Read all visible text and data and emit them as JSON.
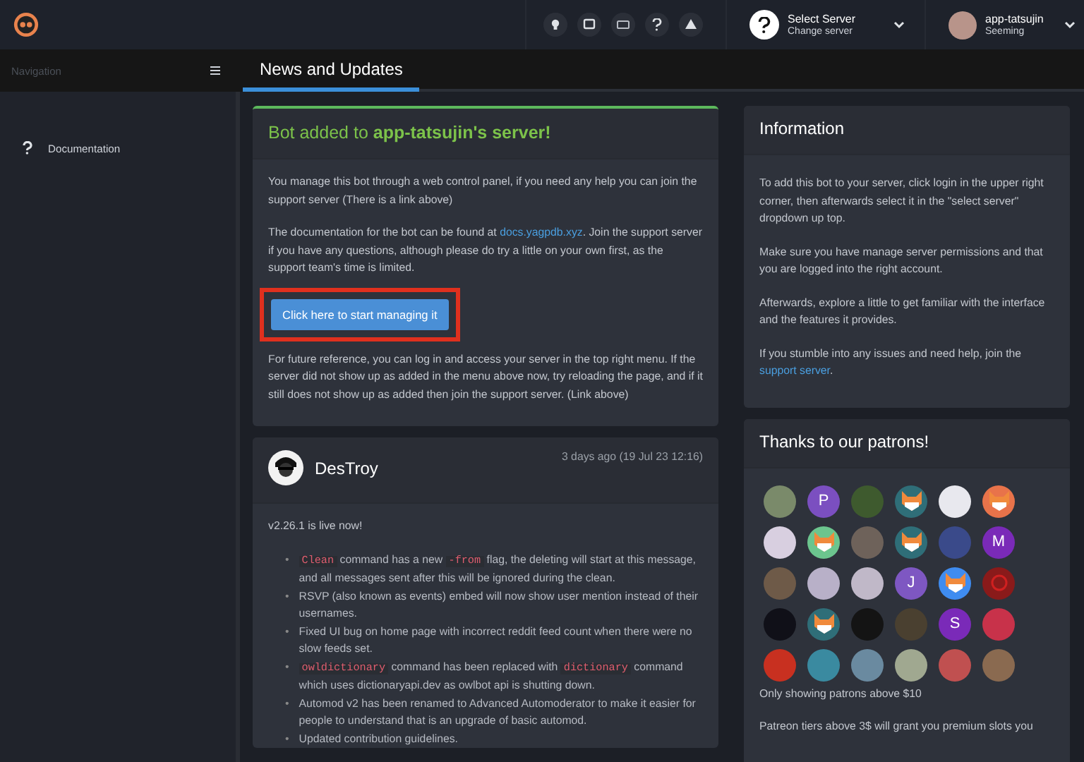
{
  "topbar": {
    "server_select": {
      "title": "Select Server",
      "subtitle": "Change server"
    },
    "user": {
      "name": "app-tatsujin",
      "status": "Seeming"
    }
  },
  "sidebar": {
    "title": "Navigation",
    "items": [
      {
        "label": "Documentation"
      }
    ]
  },
  "tabs": [
    {
      "label": "News and Updates",
      "selected": true
    }
  ],
  "welcome_card": {
    "title": "Bot added to **app-tatsujin's server!**",
    "paragraphs": [
      [
        {
          "kind": "text",
          "text": "You manage this bot through a web control panel, if you need any help you can join the support server (There is a link above)"
        }
      ],
      [
        {
          "kind": "text",
          "text": "The documentation for the bot can be found at "
        },
        {
          "kind": "link",
          "text": "docs.yagpdb.xyz"
        },
        {
          "kind": "text",
          "text": ". Join the support server if you have any questions, although please do try a little on your own first, as the support team's time is limited."
        }
      ]
    ],
    "button": {
      "label": "Click here to start managing it",
      "highlighted": true
    },
    "footer": [
      [
        {
          "kind": "text",
          "text": "For future reference, you can log in and access your server in the top right menu. If the server did not show up as added in the menu above now, try reloading the page, and if it still does not show up as added then join the support server. (Link above)"
        }
      ]
    ]
  },
  "news_post": {
    "author": "DesTroy",
    "time": "3 days ago (19 Jul 23 12:16)",
    "headline": "v2.26.1 is live now!",
    "items": [
      {
        "bullet": "•",
        "parts": [
          {
            "kind": "code",
            "text": "Clean"
          },
          {
            "kind": "text",
            "text": " command has a new "
          },
          {
            "kind": "code",
            "text": "-from"
          },
          {
            "kind": "text",
            "text": " flag, the deleting will start at this message, and all messages sent after this will be ignored during the clean."
          }
        ]
      },
      {
        "bullet": "•",
        "parts": [
          {
            "kind": "text",
            "text": "RSVP (also known as events) embed will now show user mention instead of their usernames."
          }
        ]
      },
      {
        "bullet": "•",
        "parts": [
          {
            "kind": "text",
            "text": "Fixed UI bug on home page with incorrect reddit feed count when there were no slow feeds set."
          }
        ]
      },
      {
        "bullet": "•",
        "parts": [
          {
            "kind": "code",
            "text": "owldictionary"
          },
          {
            "kind": "text",
            "text": " command has been replaced with "
          },
          {
            "kind": "code",
            "text": "dictionary"
          },
          {
            "kind": "text",
            "text": " command which uses dictionaryapi.dev as owlbot api is shutting down."
          }
        ]
      },
      {
        "bullet": "•",
        "parts": [
          {
            "kind": "text",
            "text": "Automod v2 has been renamed to Advanced Automoderator to make it easier for people to understand that is an upgrade of basic automod."
          }
        ]
      },
      {
        "bullet": "•",
        "parts": [
          {
            "kind": "text",
            "text": "Updated contribution guidelines."
          }
        ]
      }
    ]
  },
  "information": {
    "title": "Information",
    "paragraphs": [
      [
        {
          "kind": "text",
          "text": "To add this bot to your server, click login in the upper right corner, then afterwards select it in the \"select server\" dropdown up top."
        }
      ],
      [
        {
          "kind": "text",
          "text": "Make sure you have manage server permissions and that you are logged into the right account."
        }
      ],
      [
        {
          "kind": "text",
          "text": "Afterwards, explore a little to get familiar with the interface and the features it provides."
        }
      ],
      [
        {
          "kind": "text",
          "text": "If you stumble into any issues and need help, join the "
        },
        {
          "kind": "link",
          "text": "support server"
        },
        {
          "kind": "text",
          "text": "."
        }
      ]
    ]
  },
  "patrons": {
    "title": "Thanks to our patrons!",
    "avatars": [
      {
        "kind": "photo",
        "color": "#7a8a6a"
      },
      {
        "kind": "letter",
        "letter": "P",
        "color": "#7b4fc0"
      },
      {
        "kind": "photo",
        "color": "#3e5a2e"
      },
      {
        "kind": "cat",
        "color": "#2f6e78"
      },
      {
        "kind": "photo",
        "color": "#e8e8ee"
      },
      {
        "kind": "cat",
        "color": "#e8734a"
      },
      {
        "kind": "photo",
        "color": "#d8cfe0"
      },
      {
        "kind": "cat",
        "color": "#6cc58e"
      },
      {
        "kind": "photo",
        "color": "#6e625a"
      },
      {
        "kind": "cat",
        "color": "#2f6e78"
      },
      {
        "kind": "photo",
        "color": "#3a4a8a"
      },
      {
        "kind": "letter",
        "letter": "M",
        "color": "#7a2ab8"
      },
      {
        "kind": "photo",
        "color": "#6e5a48"
      },
      {
        "kind": "photo",
        "color": "#b8b0c8"
      },
      {
        "kind": "photo",
        "color": "#c0b8c8"
      },
      {
        "kind": "letter",
        "letter": "J",
        "color": "#7e57c2"
      },
      {
        "kind": "cat",
        "color": "#3f8cf0"
      },
      {
        "kind": "logo",
        "color": "#8a1a1a"
      },
      {
        "kind": "photo",
        "color": "#101018"
      },
      {
        "kind": "cat",
        "color": "#2f6e78"
      },
      {
        "kind": "photo",
        "color": "#141414"
      },
      {
        "kind": "photo",
        "color": "#4a4030"
      },
      {
        "kind": "letter",
        "letter": "S",
        "color": "#7a2ab8"
      },
      {
        "kind": "photo",
        "color": "#c8324a"
      },
      {
        "kind": "photo",
        "color": "#c83020"
      },
      {
        "kind": "photo",
        "color": "#3a8aa0"
      },
      {
        "kind": "photo",
        "color": "#6a8aa0"
      },
      {
        "kind": "photo",
        "color": "#a0a890"
      },
      {
        "kind": "photo",
        "color": "#c05050"
      },
      {
        "kind": "photo",
        "color": "#8a6a50"
      }
    ],
    "note": "Only showing patrons above $10",
    "paragraph": [
      {
        "kind": "text",
        "text": "Patreon tiers above 3$ will grant you premium slots you"
      }
    ]
  }
}
